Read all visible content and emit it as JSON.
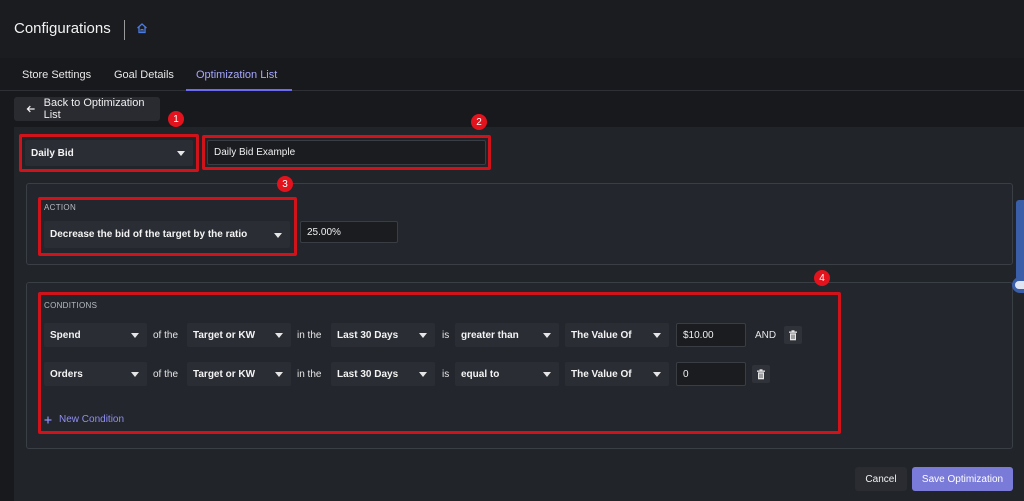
{
  "header": {
    "title": "Configurations"
  },
  "tabs": [
    {
      "label": "Store Settings"
    },
    {
      "label": "Goal Details"
    },
    {
      "label": "Optimization List"
    }
  ],
  "back_button": {
    "label": "Back to Optimization List"
  },
  "markers": [
    "1",
    "2",
    "3",
    "4"
  ],
  "optimization": {
    "type": "Daily Bid",
    "name": "Daily Bid Example"
  },
  "action": {
    "label": "ACTION",
    "selection": "Decrease the bid of the target by the ratio",
    "value": "25.00%"
  },
  "conditions": {
    "label": "CONDITIONS",
    "of_the": "of the",
    "in_the": "in the",
    "is": "is",
    "and_label": "AND",
    "rows": [
      {
        "metric": "Spend",
        "target": "Target or KW",
        "period": "Last 30 Days",
        "operator": "greater than",
        "value_type": "The Value Of",
        "value": "$10.00"
      },
      {
        "metric": "Orders",
        "target": "Target or KW",
        "period": "Last 30 Days",
        "operator": "equal to",
        "value_type": "The Value Of",
        "value": "0"
      }
    ],
    "new_condition": "New Condition"
  },
  "footer": {
    "cancel": "Cancel",
    "save": "Save Optimization"
  },
  "colors": {
    "accent": "#7a7ad8",
    "highlight": "#d0121b"
  },
  "icons": [
    "home-icon",
    "arrow-left-icon",
    "chevron-down-icon",
    "trash-icon",
    "plus-icon"
  ]
}
